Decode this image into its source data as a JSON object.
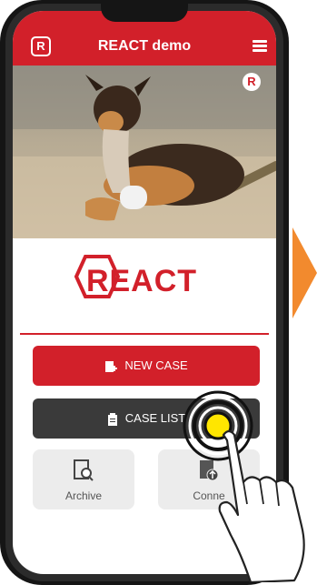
{
  "app": {
    "title": "REACT demo",
    "logo_letter": "R",
    "brand_name": "REACT"
  },
  "icons": {
    "menu": "menu-icon",
    "new_case": "add-document-icon",
    "case_list": "clipboard-icon",
    "archive": "search-document-icon",
    "connect": "upload-document-icon",
    "hero_badge": "react-badge-icon"
  },
  "buttons": {
    "new_case": "NEW CASE",
    "case_list": "CASE LIST"
  },
  "cards": {
    "archive": "Archive",
    "connect": "Conne"
  },
  "colors": {
    "brand_red": "#d2202a",
    "dark_button": "#3a3a3a",
    "touch_yellow": "#ffe600",
    "arrow_orange": "#f28a2e"
  }
}
